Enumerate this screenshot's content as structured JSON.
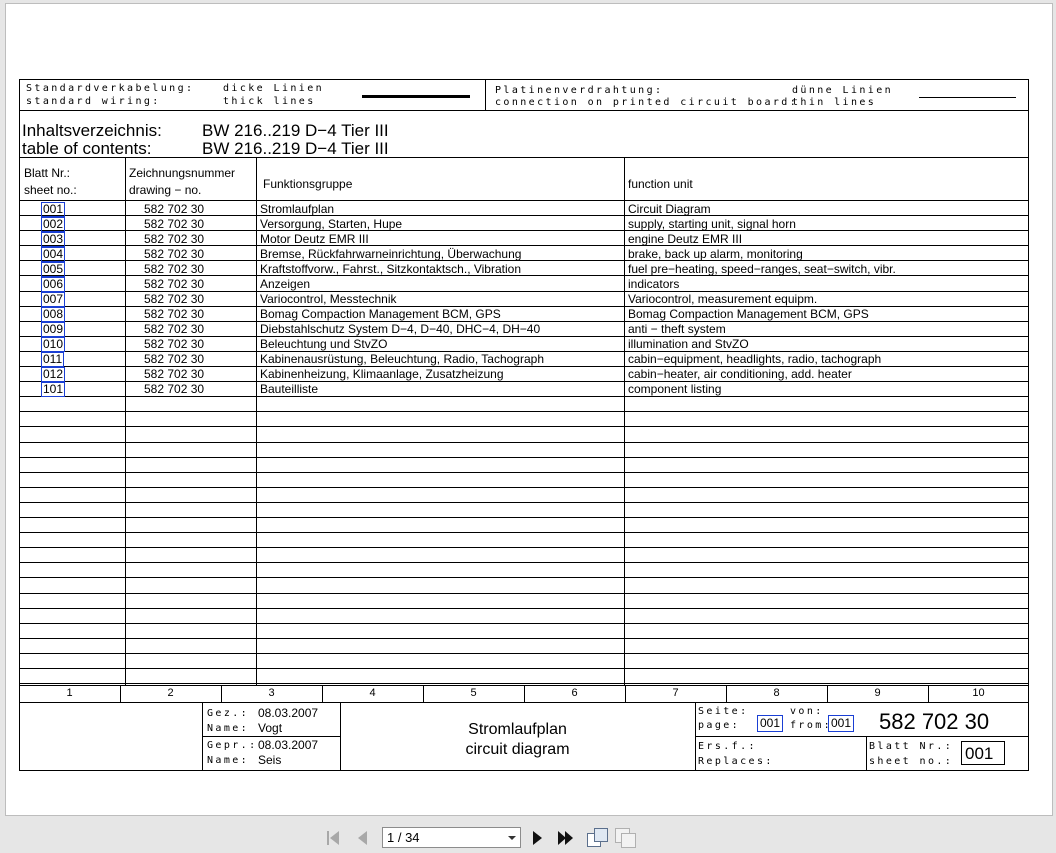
{
  "header": {
    "std_de": "Standardverkabelung:",
    "std_en": "standard wiring:",
    "thick_de": "dicke Linien",
    "thick_en": "thick lines",
    "pcb_de": "Platinenverdrahtung:",
    "pcb_en": "connection on printed circuit board:",
    "thin_de": "dünne Linien",
    "thin_en": "thin lines"
  },
  "toc": {
    "label_de": "Inhaltsverzeichnis:",
    "label_en": "table of contents:",
    "model_1": "BW 216..219 D−4 Tier III",
    "model_2": "BW 216..219 D−4 Tier III"
  },
  "columns": {
    "sheet_de": "Blatt Nr.:",
    "sheet_en": "sheet no.:",
    "drawing_de": "Zeichnungsnummer",
    "drawing_en": "drawing − no.",
    "group_de": "Funktionsgruppe",
    "unit_en": "function unit"
  },
  "rows": [
    {
      "sheet": "001",
      "drawing": "582 702 30",
      "de": "Stromlaufplan",
      "en": "Circuit Diagram"
    },
    {
      "sheet": "002",
      "drawing": "582 702 30",
      "de": "Versorgung, Starten, Hupe",
      "en": "supply, starting unit, signal horn"
    },
    {
      "sheet": "003",
      "drawing": "582 702 30",
      "de": "Motor Deutz EMR III",
      "en": "engine Deutz EMR III"
    },
    {
      "sheet": "004",
      "drawing": "582 702 30",
      "de": "Bremse, Rückfahrwarneinrichtung, Überwachung",
      "en": "brake, back up alarm, monitoring"
    },
    {
      "sheet": "005",
      "drawing": "582 702 30",
      "de": "Kraftstoffvorw., Fahrst., Sitzkontaktsch., Vibration",
      "en": "fuel pre−heating, speed−ranges, seat−switch, vibr."
    },
    {
      "sheet": "006",
      "drawing": "582 702 30",
      "de": "Anzeigen",
      "en": "indicators"
    },
    {
      "sheet": "007",
      "drawing": "582 702 30",
      "de": "Variocontrol, Messtechnik",
      "en": "Variocontrol, measurement equipm."
    },
    {
      "sheet": "008",
      "drawing": "582 702 30",
      "de": "Bomag Compaction Management BCM, GPS",
      "en": "Bomag Compaction Management BCM, GPS"
    },
    {
      "sheet": "009",
      "drawing": "582 702 30",
      "de": "Diebstahlschutz System D−4, D−40, DHC−4, DH−40",
      "en": "anti − theft system"
    },
    {
      "sheet": "010",
      "drawing": "582 702 30",
      "de": "Beleuchtung und StvZO",
      "en": "illumination and StvZO"
    },
    {
      "sheet": "011",
      "drawing": "582 702 30",
      "de": "Kabinenausrüstung, Beleuchtung, Radio, Tachograph",
      "en": "cabin−equipment, headlights, radio, tachograph"
    },
    {
      "sheet": "012",
      "drawing": "582 702 30",
      "de": "Kabinenheizung, Klimaanlage, Zusatzheizung",
      "en": "cabin−heater, air conditioning, add. heater"
    },
    {
      "sheet": "101",
      "drawing": "582 702 30",
      "de": "Bauteilliste",
      "en": "component listing"
    }
  ],
  "ruler": [
    "1",
    "2",
    "3",
    "4",
    "5",
    "6",
    "7",
    "8",
    "9",
    "10"
  ],
  "titleblock": {
    "gez_label": "Gez.:",
    "gez_date": "08.03.2007",
    "name1_label": "Name:",
    "name1": "Vogt",
    "gepr_label": "Gepr.:",
    "gepr_date": "08.03.2007",
    "name2_label": "Name:",
    "name2": "Seis",
    "title_de": "Stromlaufplan",
    "title_en": "circuit diagram",
    "seite_label": "Seite:",
    "page_label": "page:",
    "page_no": "001",
    "von_label": "von:",
    "from_label": "from:",
    "from_no": "001",
    "drawing_no": "582 702 30",
    "ersf_label": "Ers.f.:",
    "replaces_label": "Replaces:",
    "blatt_label": "Blatt Nr.:",
    "sheetno_label": "sheet no.:",
    "sheet_no": "001"
  },
  "viewer": {
    "page_field": "1 / 34"
  },
  "icons": [
    "first-page-icon",
    "previous-page-icon",
    "next-page-icon",
    "last-page-icon",
    "rotate-icon",
    "pages-icon",
    "dropdown-arrow-icon"
  ]
}
